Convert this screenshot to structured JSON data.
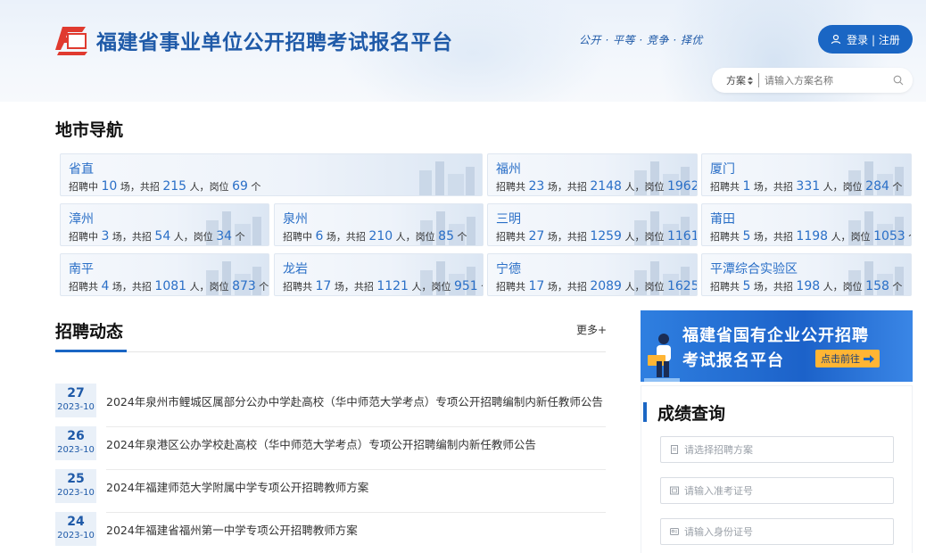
{
  "header": {
    "site_title": "福建省事业单位公开招聘考试报名平台",
    "slogan": "公开 · 平等 · 竞争 · 择优",
    "login_label": "登录 | 注册",
    "search": {
      "select_label": "方案",
      "placeholder": "请输入方案名称"
    }
  },
  "city_nav": {
    "title": "地市导航",
    "cities": [
      {
        "name": "省直",
        "status": "招聘中",
        "sessions": "10",
        "recruits": "215",
        "positions": "69"
      },
      {
        "name": "福州",
        "status": "招聘共",
        "sessions": "23",
        "recruits": "2148",
        "positions": "1962"
      },
      {
        "name": "厦门",
        "status": "招聘共",
        "sessions": "1",
        "recruits": "331",
        "positions": "284"
      },
      {
        "name": "漳州",
        "status": "招聘中",
        "sessions": "3",
        "recruits": "54",
        "positions": "34"
      },
      {
        "name": "泉州",
        "status": "招聘中",
        "sessions": "6",
        "recruits": "210",
        "positions": "85"
      },
      {
        "name": "三明",
        "status": "招聘共",
        "sessions": "27",
        "recruits": "1259",
        "positions": "1161"
      },
      {
        "name": "莆田",
        "status": "招聘共",
        "sessions": "5",
        "recruits": "1198",
        "positions": "1053"
      },
      {
        "name": "南平",
        "status": "招聘共",
        "sessions": "4",
        "recruits": "1081",
        "positions": "873"
      },
      {
        "name": "龙岩",
        "status": "招聘共",
        "sessions": "17",
        "recruits": "1121",
        "positions": "951"
      },
      {
        "name": "宁德",
        "status": "招聘共",
        "sessions": "17",
        "recruits": "2089",
        "positions": "1625"
      },
      {
        "name": "平潭综合实验区",
        "status": "招聘共",
        "sessions": "5",
        "recruits": "198",
        "positions": "158"
      }
    ],
    "labels": {
      "sessions_unit": "场，",
      "recruits_prefix": "共招",
      "recruits_unit": "人，",
      "positions_prefix": "岗位",
      "positions_unit": "个"
    }
  },
  "news": {
    "title": "招聘动态",
    "more_label": "更多+",
    "items": [
      {
        "day": "27",
        "ym": "2023-10",
        "title": "2024年泉州市鲤城区属部分公办中学赴高校（华中师范大学考点）专项公开招聘编制内新任教师公告"
      },
      {
        "day": "26",
        "ym": "2023-10",
        "title": "2024年泉港区公办学校赴高校（华中师范大学考点）专项公开招聘编制内新任教师公告"
      },
      {
        "day": "25",
        "ym": "2023-10",
        "title": "2024年福建师范大学附属中学专项公开招聘教师方案"
      },
      {
        "day": "24",
        "ym": "2023-10",
        "title": "2024年福建省福州第一中学专项公开招聘教师方案"
      }
    ]
  },
  "banner": {
    "line1": "福建省国有企业公开招聘",
    "line2": "考试报名平台",
    "cta": "点击前往"
  },
  "score_query": {
    "title": "成绩查询",
    "fields": [
      {
        "placeholder": "请选择招聘方案"
      },
      {
        "placeholder": "请输入准考证号"
      },
      {
        "placeholder": "请输入身份证号"
      }
    ]
  },
  "colors": {
    "primary": "#1a66c4",
    "link": "#2a6fc7",
    "cta": "#ffb534"
  }
}
